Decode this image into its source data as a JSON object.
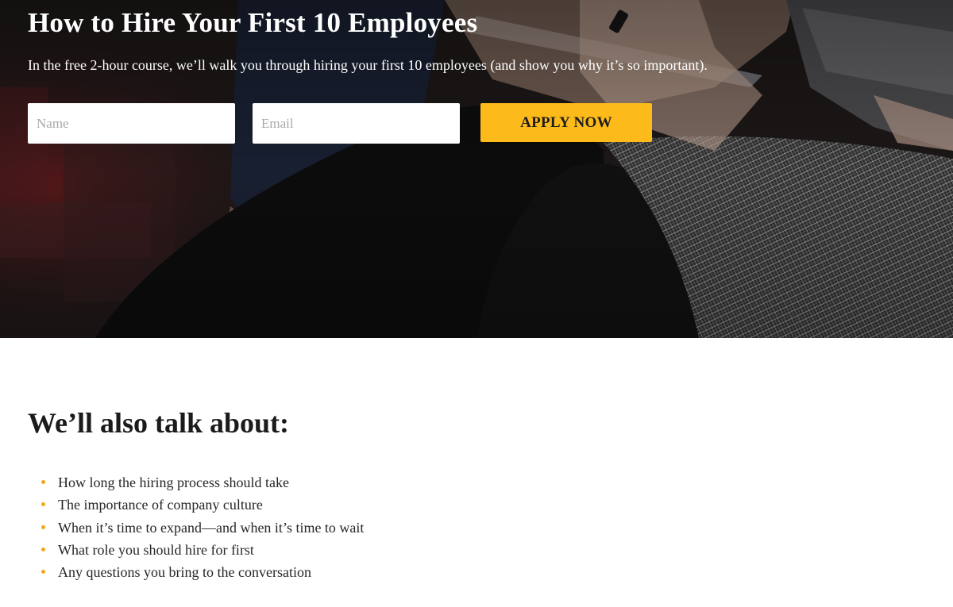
{
  "colors": {
    "accent": "#fdbb1b",
    "bullet": "#f0a81a",
    "hero_text": "#ffffff",
    "body_text": "#1f1f1f"
  },
  "hero": {
    "title": "How to Hire Your First 10 Employees",
    "subtitle": "In the free 2-hour course, we’ll walk you through hiring your first 10 employees (and show you why it’s so important).",
    "form": {
      "name_placeholder": "Name",
      "email_placeholder": "Email",
      "submit_label": "APPLY NOW"
    }
  },
  "topics": {
    "title": "We’ll also talk about:",
    "items": [
      "How long the hiring process should take",
      "The importance of company culture",
      "When it’s time to expand—and when it’s time to wait",
      "What role you should hire for first",
      "Any questions you bring to the conversation"
    ]
  }
}
